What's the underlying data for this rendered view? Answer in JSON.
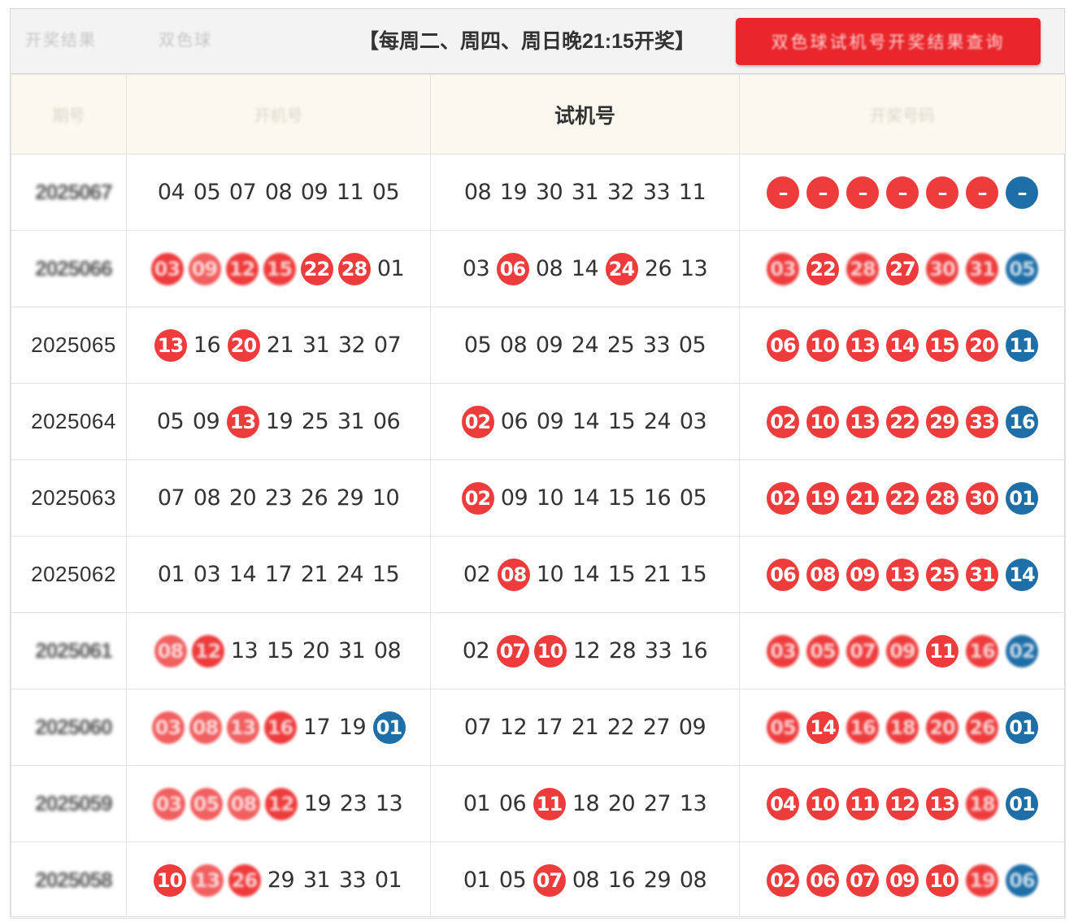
{
  "topbar": {
    "tab1": "开奖结果",
    "tab2": "双色球",
    "schedule": "【每周二、周四、周日晚21:15开奖】",
    "button_label": "双色球试机号开奖结果查询"
  },
  "header": {
    "col_issue": "期号",
    "col_open": "开机号",
    "col_trial": "试机号",
    "col_draw": "开奖号码"
  },
  "colors": {
    "red_ball": "#ee3c3d",
    "blue_ball": "#1e6ea7",
    "button": "#e8262b",
    "header_bg": "#fbf9ef"
  },
  "rows": [
    {
      "issue": "2025067",
      "issue_blurred": true,
      "open": [
        [
          "04",
          ""
        ],
        [
          "05",
          ""
        ],
        [
          "07",
          ""
        ],
        [
          "08",
          ""
        ],
        [
          "09",
          ""
        ],
        [
          "11",
          ""
        ],
        [
          "05",
          ""
        ]
      ],
      "trial": [
        [
          "08",
          ""
        ],
        [
          "19",
          ""
        ],
        [
          "30",
          ""
        ],
        [
          "31",
          ""
        ],
        [
          "32",
          ""
        ],
        [
          "33",
          ""
        ],
        [
          "11",
          ""
        ]
      ],
      "draw": [
        [
          "–",
          "red"
        ],
        [
          "–",
          "red"
        ],
        [
          "–",
          "red"
        ],
        [
          "–",
          "red"
        ],
        [
          "–",
          "red"
        ],
        [
          "–",
          "red"
        ],
        [
          "–",
          "blue"
        ]
      ]
    },
    {
      "issue": "2025066",
      "issue_blurred": true,
      "open": [
        [
          "03",
          "red-blur"
        ],
        [
          "09",
          "blur"
        ],
        [
          "12",
          "red-blur"
        ],
        [
          "15",
          "red-blur"
        ],
        [
          "22",
          "red"
        ],
        [
          "28",
          "red"
        ],
        [
          "01",
          ""
        ]
      ],
      "trial": [
        [
          "03",
          ""
        ],
        [
          "06",
          "red"
        ],
        [
          "08",
          ""
        ],
        [
          "14",
          ""
        ],
        [
          "24",
          "red"
        ],
        [
          "26",
          ""
        ],
        [
          "13",
          ""
        ]
      ],
      "draw": [
        [
          "03",
          "red-blur"
        ],
        [
          "22",
          "red"
        ],
        [
          "28",
          "red-blur"
        ],
        [
          "27",
          "red"
        ],
        [
          "30",
          "red-blur"
        ],
        [
          "31",
          "red-blur"
        ],
        [
          "05",
          "blue-blur"
        ]
      ]
    },
    {
      "issue": "2025065",
      "issue_blurred": false,
      "open": [
        [
          "13",
          "red"
        ],
        [
          "16",
          ""
        ],
        [
          "20",
          "red"
        ],
        [
          "21",
          ""
        ],
        [
          "31",
          ""
        ],
        [
          "32",
          ""
        ],
        [
          "07",
          ""
        ]
      ],
      "trial": [
        [
          "05",
          ""
        ],
        [
          "08",
          ""
        ],
        [
          "09",
          ""
        ],
        [
          "24",
          ""
        ],
        [
          "25",
          ""
        ],
        [
          "33",
          ""
        ],
        [
          "05",
          ""
        ]
      ],
      "draw": [
        [
          "06",
          "red"
        ],
        [
          "10",
          "red"
        ],
        [
          "13",
          "red"
        ],
        [
          "14",
          "red"
        ],
        [
          "15",
          "red"
        ],
        [
          "20",
          "red"
        ],
        [
          "11",
          "blue"
        ]
      ]
    },
    {
      "issue": "2025064",
      "issue_blurred": false,
      "open": [
        [
          "05",
          ""
        ],
        [
          "09",
          ""
        ],
        [
          "13",
          "red"
        ],
        [
          "19",
          ""
        ],
        [
          "25",
          ""
        ],
        [
          "31",
          ""
        ],
        [
          "06",
          ""
        ]
      ],
      "trial": [
        [
          "02",
          "red"
        ],
        [
          "06",
          ""
        ],
        [
          "09",
          ""
        ],
        [
          "14",
          ""
        ],
        [
          "15",
          ""
        ],
        [
          "24",
          ""
        ],
        [
          "03",
          ""
        ]
      ],
      "draw": [
        [
          "02",
          "red"
        ],
        [
          "10",
          "red"
        ],
        [
          "13",
          "red"
        ],
        [
          "22",
          "red"
        ],
        [
          "29",
          "red"
        ],
        [
          "33",
          "red"
        ],
        [
          "16",
          "blue"
        ]
      ]
    },
    {
      "issue": "2025063",
      "issue_blurred": false,
      "open": [
        [
          "07",
          ""
        ],
        [
          "08",
          ""
        ],
        [
          "20",
          ""
        ],
        [
          "23",
          ""
        ],
        [
          "26",
          ""
        ],
        [
          "29",
          ""
        ],
        [
          "10",
          ""
        ]
      ],
      "trial": [
        [
          "02",
          "red"
        ],
        [
          "09",
          ""
        ],
        [
          "10",
          ""
        ],
        [
          "14",
          ""
        ],
        [
          "15",
          ""
        ],
        [
          "16",
          ""
        ],
        [
          "05",
          ""
        ]
      ],
      "draw": [
        [
          "02",
          "red"
        ],
        [
          "19",
          "red"
        ],
        [
          "21",
          "red"
        ],
        [
          "22",
          "red"
        ],
        [
          "28",
          "red"
        ],
        [
          "30",
          "red"
        ],
        [
          "01",
          "blue"
        ]
      ]
    },
    {
      "issue": "2025062",
      "issue_blurred": false,
      "open": [
        [
          "01",
          ""
        ],
        [
          "03",
          ""
        ],
        [
          "14",
          ""
        ],
        [
          "17",
          ""
        ],
        [
          "21",
          ""
        ],
        [
          "24",
          ""
        ],
        [
          "15",
          ""
        ]
      ],
      "trial": [
        [
          "02",
          ""
        ],
        [
          "08",
          "red"
        ],
        [
          "10",
          ""
        ],
        [
          "14",
          ""
        ],
        [
          "15",
          ""
        ],
        [
          "21",
          ""
        ],
        [
          "15",
          ""
        ]
      ],
      "draw": [
        [
          "06",
          "red"
        ],
        [
          "08",
          "red"
        ],
        [
          "09",
          "red"
        ],
        [
          "13",
          "red"
        ],
        [
          "25",
          "red"
        ],
        [
          "31",
          "red"
        ],
        [
          "14",
          "blue"
        ]
      ]
    },
    {
      "issue": "2025061",
      "issue_blurred": true,
      "open": [
        [
          "08",
          "blur"
        ],
        [
          "12",
          "red-blur"
        ],
        [
          "13",
          ""
        ],
        [
          "15",
          ""
        ],
        [
          "20",
          ""
        ],
        [
          "31",
          ""
        ],
        [
          "08",
          ""
        ]
      ],
      "trial": [
        [
          "02",
          ""
        ],
        [
          "07",
          "red"
        ],
        [
          "10",
          "red"
        ],
        [
          "12",
          ""
        ],
        [
          "28",
          ""
        ],
        [
          "33",
          ""
        ],
        [
          "16",
          ""
        ]
      ],
      "draw": [
        [
          "03",
          "red-blur"
        ],
        [
          "05",
          "red-blur"
        ],
        [
          "07",
          "red-blur"
        ],
        [
          "09",
          "red-blur"
        ],
        [
          "11",
          "red"
        ],
        [
          "16",
          "red-blur"
        ],
        [
          "02",
          "blue-blur"
        ]
      ]
    },
    {
      "issue": "2025060",
      "issue_blurred": true,
      "open": [
        [
          "03",
          "blur"
        ],
        [
          "08",
          "blur"
        ],
        [
          "13",
          "blur"
        ],
        [
          "16",
          "red-blur"
        ],
        [
          "17",
          ""
        ],
        [
          "19",
          ""
        ],
        [
          "01",
          "blue"
        ]
      ],
      "trial": [
        [
          "07",
          ""
        ],
        [
          "12",
          ""
        ],
        [
          "17",
          ""
        ],
        [
          "21",
          ""
        ],
        [
          "22",
          ""
        ],
        [
          "27",
          ""
        ],
        [
          "09",
          ""
        ]
      ],
      "draw": [
        [
          "05",
          "red-blur"
        ],
        [
          "14",
          "red"
        ],
        [
          "16",
          "red-blur"
        ],
        [
          "18",
          "red-blur"
        ],
        [
          "20",
          "red-blur"
        ],
        [
          "26",
          "red-blur"
        ],
        [
          "01",
          "blue"
        ]
      ]
    },
    {
      "issue": "2025059",
      "issue_blurred": true,
      "open": [
        [
          "03",
          "blur"
        ],
        [
          "05",
          "blur"
        ],
        [
          "08",
          "blur"
        ],
        [
          "12",
          "red-blur"
        ],
        [
          "19",
          ""
        ],
        [
          "23",
          ""
        ],
        [
          "13",
          ""
        ]
      ],
      "trial": [
        [
          "01",
          ""
        ],
        [
          "06",
          ""
        ],
        [
          "11",
          "red"
        ],
        [
          "18",
          ""
        ],
        [
          "20",
          ""
        ],
        [
          "27",
          ""
        ],
        [
          "13",
          ""
        ]
      ],
      "draw": [
        [
          "04",
          "red"
        ],
        [
          "10",
          "red"
        ],
        [
          "11",
          "red"
        ],
        [
          "12",
          "red"
        ],
        [
          "13",
          "red"
        ],
        [
          "18",
          "red-blur"
        ],
        [
          "01",
          "blue"
        ]
      ]
    },
    {
      "issue": "2025058",
      "issue_blurred": true,
      "open": [
        [
          "10",
          "red"
        ],
        [
          "13",
          "blur"
        ],
        [
          "26",
          "red-blur"
        ],
        [
          "29",
          ""
        ],
        [
          "31",
          ""
        ],
        [
          "33",
          ""
        ],
        [
          "01",
          ""
        ]
      ],
      "trial": [
        [
          "01",
          ""
        ],
        [
          "05",
          ""
        ],
        [
          "07",
          "red"
        ],
        [
          "08",
          ""
        ],
        [
          "16",
          ""
        ],
        [
          "29",
          ""
        ],
        [
          "08",
          ""
        ]
      ],
      "draw": [
        [
          "02",
          "red"
        ],
        [
          "06",
          "red"
        ],
        [
          "07",
          "red"
        ],
        [
          "09",
          "red"
        ],
        [
          "10",
          "red"
        ],
        [
          "19",
          "red-blur"
        ],
        [
          "06",
          "blue-blur"
        ]
      ]
    }
  ]
}
